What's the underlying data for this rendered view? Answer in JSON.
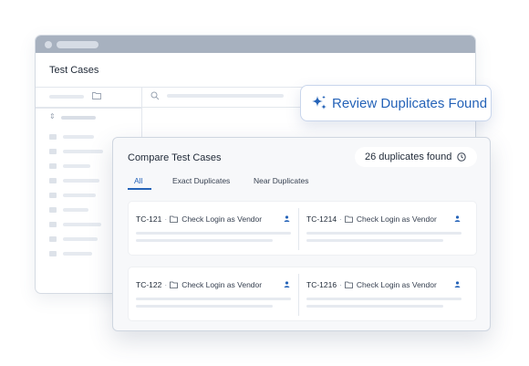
{
  "window": {
    "title": "Test Cases"
  },
  "review_banner": {
    "label": "Review Duplicates Found",
    "icon": "sparkle-icon"
  },
  "compare": {
    "title": "Compare Test Cases",
    "duplicates_badge": "26 duplicates found",
    "tabs": [
      {
        "label": "All",
        "active": true
      },
      {
        "label": "Exact Duplicates",
        "active": false
      },
      {
        "label": "Near Duplicates",
        "active": false
      }
    ],
    "pairs": [
      {
        "left": {
          "id": "TC-121",
          "name": "Check Login as Vendor"
        },
        "right": {
          "id": "TC-1214",
          "name": "Check Login as Vendor"
        }
      },
      {
        "left": {
          "id": "TC-122",
          "name": "Check Login as Vendor"
        },
        "right": {
          "id": "TC-1216",
          "name": "Check Login as Vendor"
        }
      }
    ]
  },
  "colors": {
    "accent": "#2563b8",
    "titlebar": "#a7b1bf",
    "panel_bg": "#f7f8fa"
  }
}
